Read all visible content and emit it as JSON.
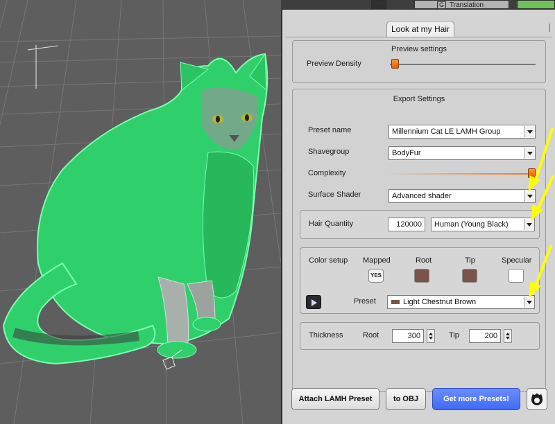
{
  "viewport": {
    "subject_icon": "green-fur-cat-render"
  },
  "top_strip": {
    "translation_label": "Translation",
    "translation_key": "G"
  },
  "tab": {
    "label": "Look at my Hair"
  },
  "preview": {
    "title": "Preview settings",
    "density_label": "Preview Density",
    "density_level": 0.02
  },
  "export": {
    "title": "Export Settings",
    "preset_name_label": "Preset name",
    "preset_name_value": "Millennium Cat LE LAMH Group",
    "shavegroup_label": "Shavegroup",
    "shavegroup_value": "BodyFur",
    "complexity_label": "Complexity",
    "complexity_level": 1.0,
    "surface_shader_label": "Surface Shader",
    "surface_shader_value": "Advanced shader",
    "hair_quantity_label": "Hair Quantity",
    "hair_quantity_value": "120000",
    "hair_type_value": "Human (Young Black)",
    "color_setup": {
      "label": "Color setup",
      "mapped_label": "Mapped",
      "mapped_value": "YES",
      "root_label": "Root",
      "root_color": "#7a5448",
      "tip_label": "Tip",
      "tip_color": "#7a5448",
      "specular_label": "Specular",
      "specular_color": "#ffffff",
      "preset_label": "Preset",
      "preset_value": "Light Chestnut Brown"
    },
    "thickness": {
      "label": "Thickness",
      "root_label": "Root",
      "root_value": "300",
      "tip_label": "Tip",
      "tip_value": "200"
    }
  },
  "buttons": {
    "attach": "Attach LAMH Preset",
    "to_obj": "to OBJ",
    "get_more": "Get more Presets!"
  },
  "colors": {
    "accent_orange": "#f07010",
    "fur_green": "#3ee07a",
    "annotation_yellow": "#ffff00",
    "primary_blue": "#4f78ff"
  }
}
